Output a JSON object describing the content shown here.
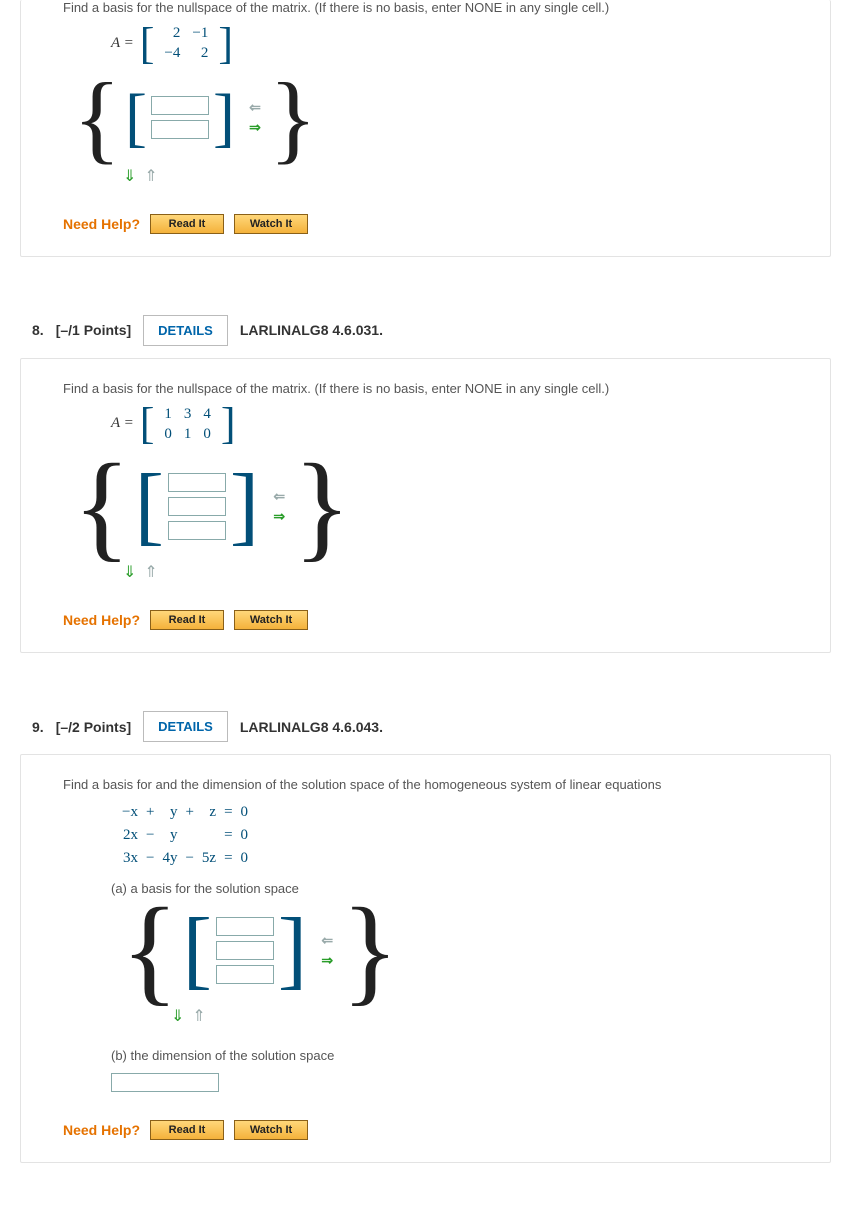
{
  "q7": {
    "prompt": "Find a basis for the nullspace of the matrix. (If there is no basis, enter NONE in any single cell.)",
    "matrixLabel": "A =",
    "matrix": [
      [
        "2",
        "−1"
      ],
      [
        "−4",
        "2"
      ]
    ]
  },
  "q8": {
    "num": "8.",
    "points": "[–/1 Points]",
    "detailsLabel": "DETAILS",
    "ref": "LARLINALG8 4.6.031.",
    "prompt": "Find a basis for the nullspace of the matrix. (If there is no basis, enter NONE in any single cell.)",
    "matrixLabel": "A =",
    "matrix": [
      [
        "1",
        "3",
        "4"
      ],
      [
        "0",
        "1",
        "0"
      ]
    ]
  },
  "q9": {
    "num": "9.",
    "points": "[–/2 Points]",
    "detailsLabel": "DETAILS",
    "ref": "LARLINALG8 4.6.043.",
    "prompt": "Find a basis for and the dimension of the solution space of the homogeneous system of linear equations",
    "equations": {
      "r1": {
        "c1": "−x",
        "c2": "+",
        "c3": "y",
        "c4": "+",
        "c5": "z",
        "c6": "=",
        "c7": "0"
      },
      "r2": {
        "c1": "2x",
        "c2": "−",
        "c3": "y",
        "c4": "",
        "c5": "",
        "c6": "=",
        "c7": "0"
      },
      "r3": {
        "c1": "3x",
        "c2": "−",
        "c3": "4y",
        "c4": "−",
        "c5": "5z",
        "c6": "=",
        "c7": "0"
      }
    },
    "partA": "(a) a basis for the solution space",
    "partB": "(b) the dimension of the solution space"
  },
  "help": {
    "label": "Need Help?",
    "read": "Read It",
    "watch": "Watch It"
  },
  "arrows": {
    "left": "⇐",
    "right": "⇒",
    "down": "⇓",
    "up": "⇑"
  }
}
